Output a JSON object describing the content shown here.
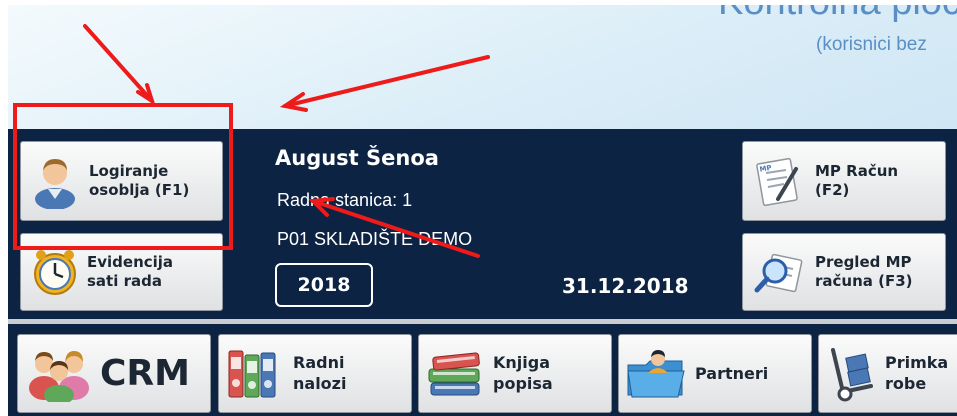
{
  "banner": {
    "title": "Kontrolna ploča",
    "subtitle": "(korisnici bez"
  },
  "buttons": {
    "login": {
      "line1": "Logiranje",
      "line2": "osoblja (F1)",
      "icon": "person-icon"
    },
    "attendance": {
      "line1": "Evidencija",
      "line2": "sati rada",
      "icon": "clock-icon"
    },
    "mp_invoice": {
      "line1": "MP Račun",
      "line2": "(F2)",
      "icon": "invoice-pen-icon"
    },
    "mp_review": {
      "line1": "Pregled MP",
      "line2": "računa (F3)",
      "icon": "magnifier-icon"
    }
  },
  "session": {
    "user_name": "August Šenoa",
    "workstation": "Radna stanica: 1",
    "store": "P01 SKLADIŠTE DEMO",
    "year": "2018",
    "date": "31.12.2018"
  },
  "modules": [
    {
      "label": "CRM",
      "icon": "people-group-icon"
    },
    {
      "line1": "Radni",
      "line2": "nalozi",
      "icon": "binders-icon"
    },
    {
      "line1": "Knjiga",
      "line2": "popisa",
      "icon": "books-icon"
    },
    {
      "label": "Partneri",
      "icon": "folder-person-icon"
    },
    {
      "line1": "Primka",
      "line2": "robe",
      "icon": "hand-truck-icon"
    }
  ],
  "annotations": {
    "color": "#ee1b1b"
  },
  "colors": {
    "panel": "#0d2343",
    "banner_text": "#5a8fc6"
  }
}
